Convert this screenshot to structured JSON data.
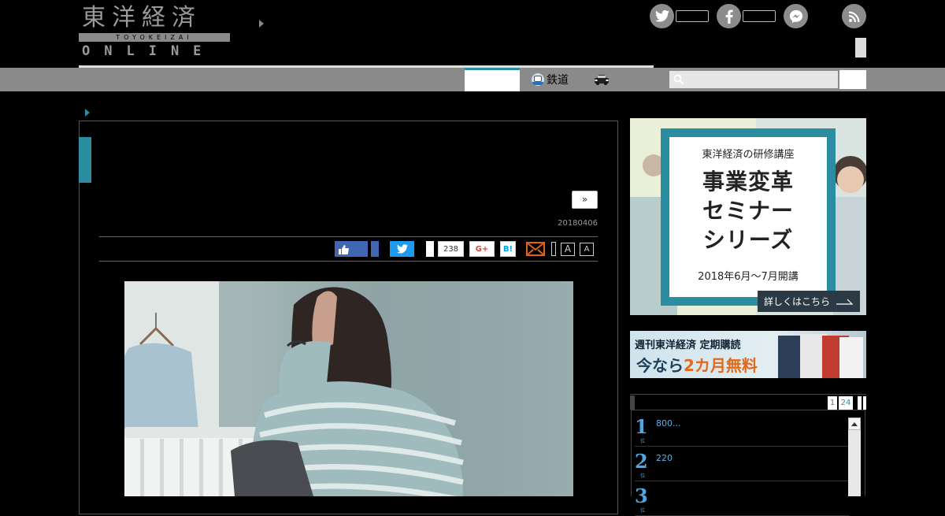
{
  "header": {
    "logo_kanji": "東洋経済",
    "logo_roman": "TOYOKEIZAI",
    "logo_online": "ONLINE"
  },
  "nav": {
    "rail_label": "鉄道"
  },
  "search": {
    "placeholder": ""
  },
  "article": {
    "next_label": "»",
    "date": "20180406",
    "share": {
      "pocket_count": "238",
      "gplus_label": "G+",
      "hatena_label": "B!",
      "font_large": "A",
      "font_small": "A"
    }
  },
  "sidebar": {
    "ad1": {
      "kicker": "東洋経済の研修講座",
      "title_line1": "事業変革",
      "title_line2": "セミナー",
      "title_line3": "シリーズ",
      "dates": "2018年6月～7月開講",
      "cta": "詳しくはこちら"
    },
    "ad2": {
      "top": "週刊東洋経済 定期購読",
      "main_prefix": "今なら",
      "main_highlight": "2カ月無料"
    },
    "ranking": {
      "tabs": [
        "1",
        "24"
      ],
      "items": [
        {
          "rank": "1",
          "unit": "位",
          "title": "800..."
        },
        {
          "rank": "2",
          "unit": "位",
          "title": "220"
        },
        {
          "rank": "3",
          "unit": "位",
          "title": ""
        }
      ]
    }
  },
  "colors": {
    "accent": "#2a8ea0",
    "nav_bar": "#8a8a8a",
    "rank_blue": "#4fa6e0"
  }
}
